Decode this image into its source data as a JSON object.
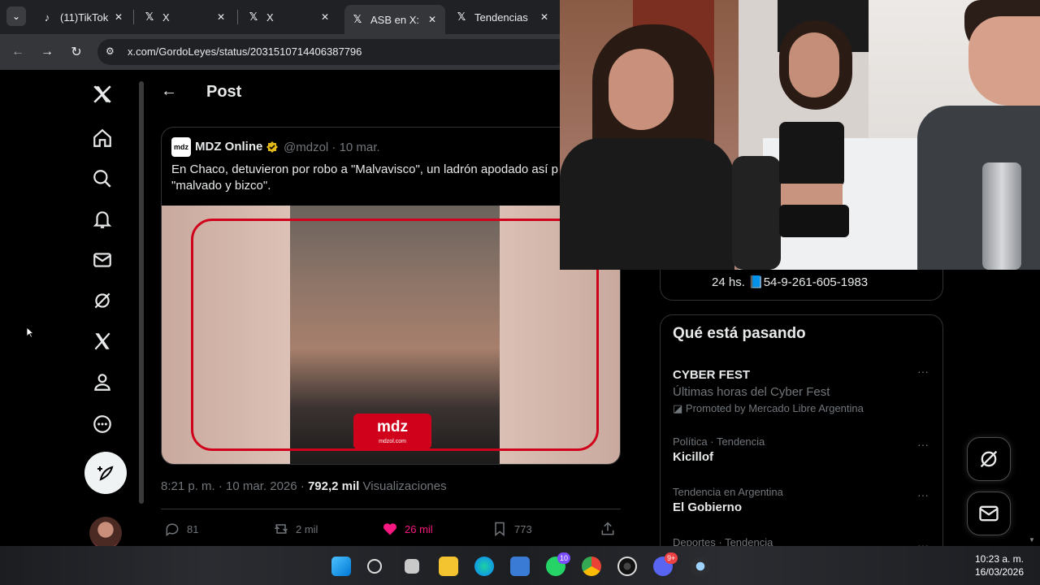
{
  "browser": {
    "tabs": [
      {
        "label": "(11)TikTok",
        "favicon": "tiktok-icon",
        "active": false
      },
      {
        "label": "X",
        "favicon": "x-logo-icon",
        "active": false
      },
      {
        "label": "X",
        "favicon": "x-logo-icon",
        "active": false
      },
      {
        "label": "ASB en X:",
        "favicon": "x-logo-icon",
        "active": true
      },
      {
        "label": "Tendencias",
        "favicon": "x-logo-icon",
        "active": false
      }
    ],
    "url": "x.com/GordoLeyes/status/2031510714406387796"
  },
  "header": {
    "title": "Post"
  },
  "quoted_post": {
    "logo_text": "mdz",
    "author": "MDZ Online",
    "handle_date": "@mdzol · 10 mar.",
    "text": "En Chaco, detuvieron por robo a \"Malvavisco\", un ladrón apodado así p es \"malvado y bizco\".",
    "media_logo": "mdz",
    "media_logo_sub": "mdzol.com"
  },
  "post_meta": {
    "time": "8:21 p. m. · 10 mar. 2026 · ",
    "views": "792,2 mil",
    "views_label": " Visualizaciones"
  },
  "actions": {
    "replies": "81",
    "reposts": "2 mil",
    "likes": "26 mil",
    "bookmarks": "773"
  },
  "sidebar": {
    "contact": "24 hs. 📘54-9-261-605-1983",
    "trends_title": "Qué está pasando",
    "trends": [
      {
        "context": "",
        "name": "CYBER FEST",
        "sub": "Últimas horas del Cyber Fest",
        "promo": "Promoted by Mercado Libre Argentina"
      },
      {
        "context": "Política · Tendencia",
        "name": "Kicillof"
      },
      {
        "context": "Tendencia en Argentina",
        "name": "El Gobierno"
      },
      {
        "context": "Deportes · Tendencia",
        "name": ""
      }
    ]
  },
  "taskbar": {
    "whatsapp_badge": "10",
    "discord_badge": "9+",
    "time": "10:23 a. m.",
    "date": "16/03/2026"
  },
  "colors": {
    "background": "#000000",
    "like": "#f91880",
    "mdz_red": "#d0021b",
    "verified": "#e2b719"
  }
}
